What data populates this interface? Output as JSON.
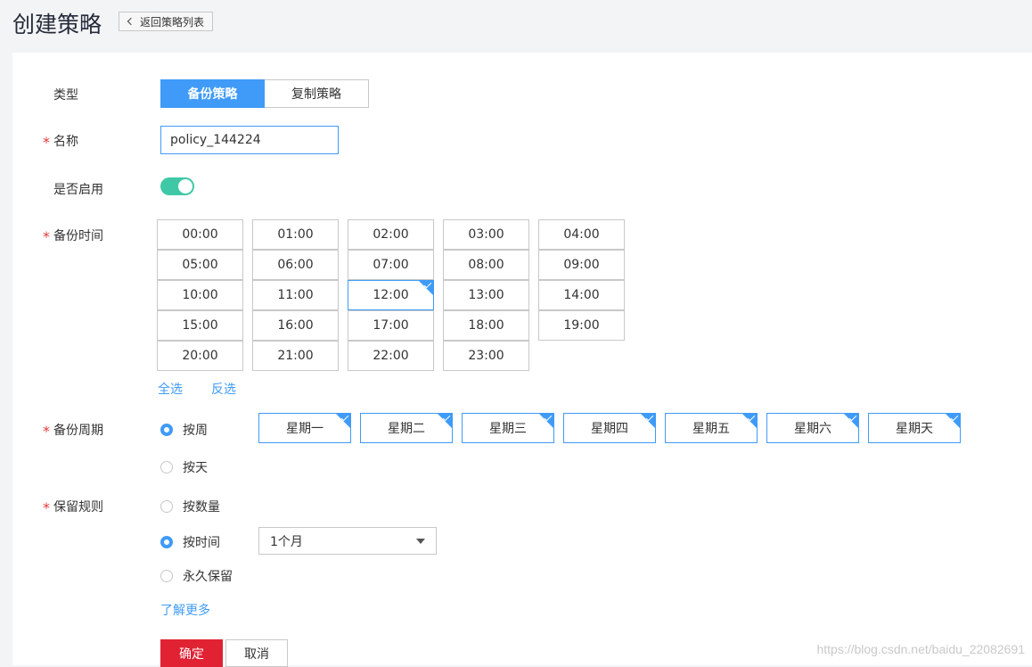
{
  "header": {
    "title": "创建策略",
    "back_label": "返回策略列表"
  },
  "form": {
    "type": {
      "label": "类型",
      "options": [
        "备份策略",
        "复制策略"
      ],
      "selected": "备份策略"
    },
    "name": {
      "label": "名称",
      "value": "policy_144224",
      "required": true
    },
    "enabled": {
      "label": "是否启用",
      "on": true
    },
    "backup_time": {
      "label": "备份时间",
      "required": true,
      "times": [
        "00:00",
        "01:00",
        "02:00",
        "03:00",
        "04:00",
        "05:00",
        "06:00",
        "07:00",
        "08:00",
        "09:00",
        "10:00",
        "11:00",
        "12:00",
        "13:00",
        "14:00",
        "15:00",
        "16:00",
        "17:00",
        "18:00",
        "19:00",
        "20:00",
        "21:00",
        "22:00",
        "23:00"
      ],
      "selected": [
        "12:00"
      ],
      "select_all_label": "全选",
      "invert_label": "反选"
    },
    "backup_cycle": {
      "label": "备份周期",
      "required": true,
      "by_week_label": "按周",
      "by_day_label": "按天",
      "selected_mode": "按周",
      "days": [
        "星期一",
        "星期二",
        "星期三",
        "星期四",
        "星期五",
        "星期六",
        "星期天"
      ],
      "selected_days": [
        "星期一",
        "星期二",
        "星期三",
        "星期四",
        "星期五",
        "星期六",
        "星期天"
      ]
    },
    "retention": {
      "label": "保留规则",
      "required": true,
      "by_count_label": "按数量",
      "by_time_label": "按时间",
      "forever_label": "永久保留",
      "selected_mode": "按时间",
      "time_value": "1个月",
      "learn_more_label": "了解更多"
    }
  },
  "actions": {
    "ok_label": "确定",
    "cancel_label": "取消"
  },
  "watermark": "https://blog.csdn.net/baidu_22082691",
  "colors": {
    "accent": "#3f9bf7",
    "danger": "#e02233",
    "toggle_on": "#3fc8a6",
    "required_star": "#e5393d"
  }
}
